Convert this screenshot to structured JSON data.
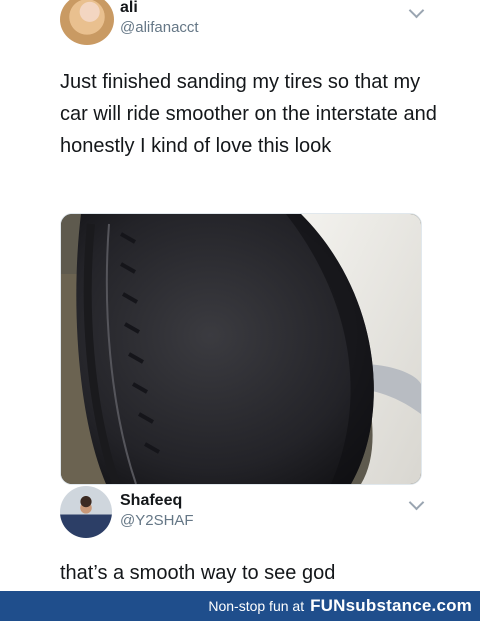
{
  "tweet": {
    "author_name": "ali",
    "author_handle": "@alifanacct",
    "text": "Just finished sanding my tires so that my car will ride smoother on the interstate and honestly I kind of love this look",
    "avatar_icon": "user-avatar-photo",
    "media_icon": "tire-photo"
  },
  "reply": {
    "author_name": "Shafeeq",
    "author_handle": "@Y2SHAF",
    "text": "that’s a smooth way to see god",
    "avatar_icon": "user-avatar-photo"
  },
  "footer": {
    "tagline": "Non-stop fun at",
    "brand": "FUNsubstance.com",
    "background": "#1f4e8c"
  }
}
